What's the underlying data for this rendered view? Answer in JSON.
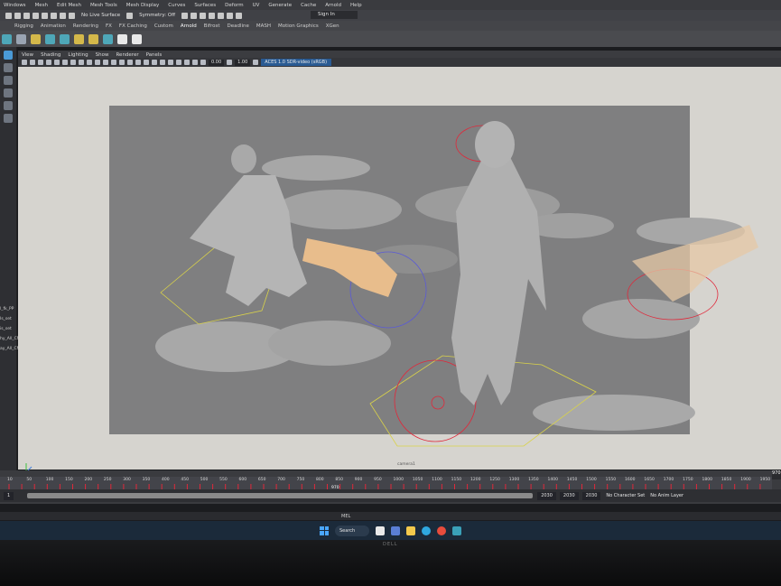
{
  "menubar": {
    "items": [
      "Windows",
      "Mesh",
      "Edit Mesh",
      "Mesh Tools",
      "Mesh Display",
      "Curves",
      "Surfaces",
      "Deform",
      "UV",
      "Generate",
      "Cache",
      "Arnold",
      "Help"
    ]
  },
  "statusline": {
    "live_surface": "No Live Surface",
    "symmetry": "Symmetry: Off",
    "sign_in": "Sign In"
  },
  "shelf": {
    "tabs": [
      "Rigging",
      "Animation",
      "Rendering",
      "FX",
      "FX Caching",
      "Custom",
      "Arnold",
      "Bifrost",
      "Deadline",
      "MASH",
      "Motion Graphics",
      "XGen"
    ],
    "active_tab": "Arnold"
  },
  "panel": {
    "menus": [
      "View",
      "Shading",
      "Lighting",
      "Show",
      "Renderer",
      "Panels"
    ],
    "exposure": "0.00",
    "gamma": "1.00",
    "color_space": "ACES 1.0 SDR-video (sRGB)",
    "camera": "camera1"
  },
  "outliner": {
    "items": [
      "l_fk_PP",
      "Is_set",
      "is_set",
      "hy_All_CNTs",
      "ay_All_CNTs"
    ]
  },
  "timeline": {
    "ticks": [
      "10",
      "50",
      "100",
      "150",
      "200",
      "250",
      "300",
      "350",
      "400",
      "450",
      "500",
      "550",
      "600",
      "650",
      "700",
      "750",
      "800",
      "850",
      "900",
      "950",
      "1000",
      "1050",
      "1100",
      "1150",
      "1200",
      "1250",
      "1300",
      "1350",
      "1400",
      "1450",
      "1500",
      "1550",
      "1600",
      "1650",
      "1700",
      "1750",
      "1800",
      "1850",
      "1900",
      "1950"
    ],
    "playhead_label": "970",
    "current_frame": "970"
  },
  "range": {
    "start": "1",
    "end_inner": "2030",
    "end_outer": "2030",
    "max": "2030",
    "character_set": "No Character Set",
    "anim_layer": "No Anim Layer"
  },
  "command": {
    "mel": "MEL"
  },
  "taskbar": {
    "search": "Search"
  },
  "monitor": {
    "brand": "DELL"
  },
  "colors": {
    "viewport_bg": "#d9d7d2",
    "dark_bg": "#7f7f80",
    "accent_blue": "#2a5b93",
    "keyframe_red": "#e0283a"
  }
}
